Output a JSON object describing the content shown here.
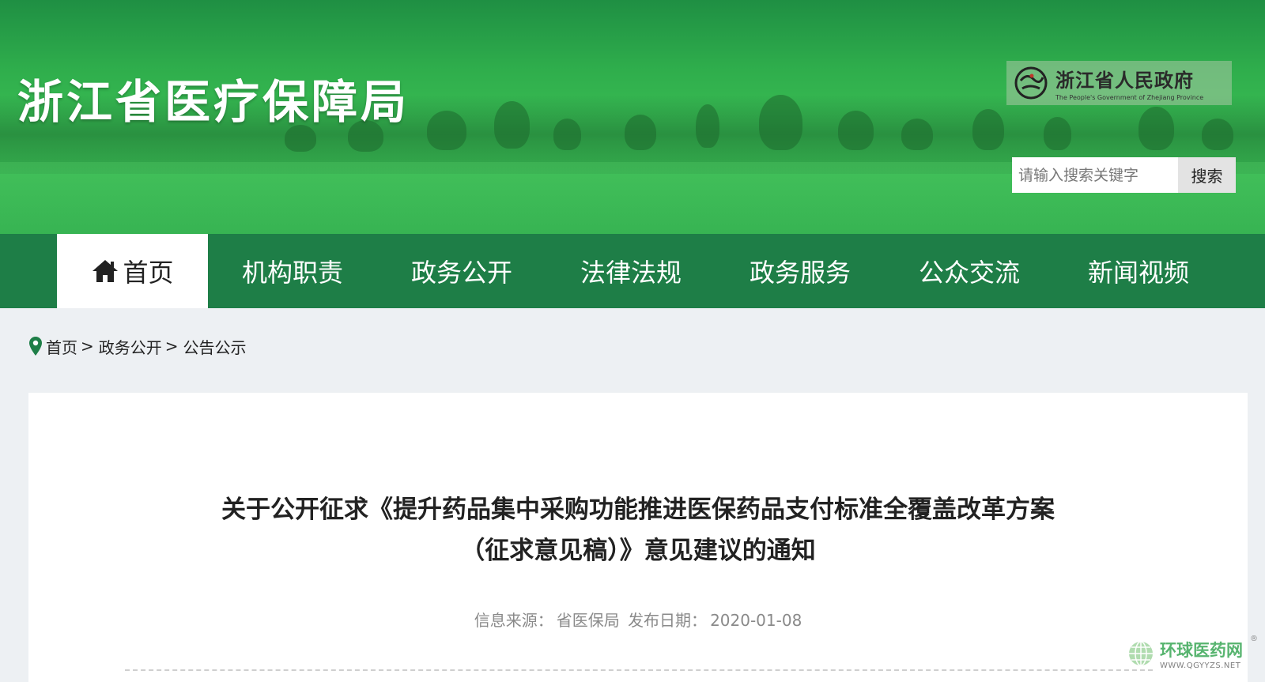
{
  "header": {
    "site_title": "浙江省医疗保障局",
    "gov_logo_cn": "浙江省人民政府",
    "gov_logo_en": "The People's Government of Zhejiang Province",
    "search_placeholder": "请输入搜索关键字",
    "search_button": "搜索"
  },
  "nav": {
    "items": [
      {
        "label": "首页",
        "icon": "home-icon",
        "active": true
      },
      {
        "label": "机构职责"
      },
      {
        "label": "政务公开"
      },
      {
        "label": "法律法规"
      },
      {
        "label": "政务服务"
      },
      {
        "label": "公众交流"
      },
      {
        "label": "新闻视频"
      }
    ]
  },
  "breadcrumb": {
    "icon": "location-pin-icon",
    "items": [
      "首页",
      "政务公开",
      "公告公示"
    ],
    "separator": ">"
  },
  "article": {
    "title_line1": "关于公开征求《提升药品集中采购功能推进医保药品支付标准全覆盖改革方案",
    "title_line2": "（征求意见稿）》意见建议的通知",
    "source_label": "信息来源：",
    "source_value": "省医保局",
    "date_label": "发布日期：",
    "date_value": "2020-01-08"
  },
  "watermark": {
    "name_cn": "环球医药网",
    "url": "WWW.QGYYZS.NET",
    "reg": "®"
  },
  "colors": {
    "nav_bg": "#1e7e47",
    "banner_green": "#36b152",
    "page_bg": "#edf0f3"
  }
}
